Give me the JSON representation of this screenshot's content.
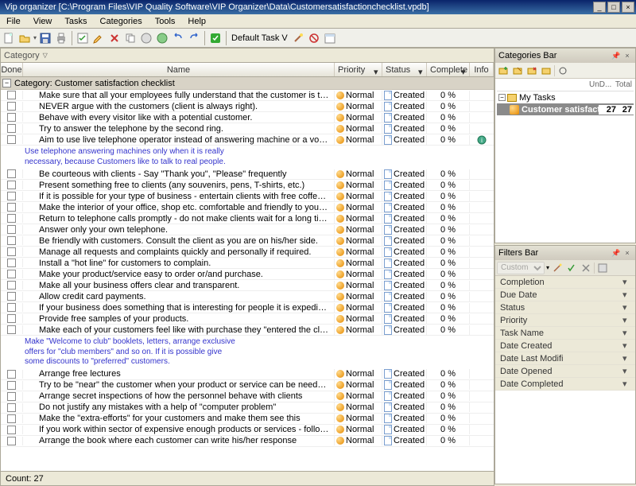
{
  "title": "Vip organizer [C:\\Program Files\\VIP Quality Software\\VIP Organizer\\Data\\Customersatisfactionchecklist.vpdb]",
  "menu": [
    "File",
    "View",
    "Tasks",
    "Categories",
    "Tools",
    "Help"
  ],
  "toolbar_dropdown": "Default Task V",
  "category_dropdown_label": "Category",
  "columns": {
    "done": "Done",
    "name": "Name",
    "priority": "Priority",
    "status": "Status",
    "complete": "Complete",
    "info": "Info"
  },
  "category_row": "Category: Customer satisfaction checklist",
  "priority_label": "Normal",
  "status_label": "Created",
  "complete_label": "0 %",
  "note1": "Use telephone answering machines only when it is really\nnecessary, because Customers like to talk to real people.",
  "note2": "Make \"Welcome to club\" booklets, letters, arrange exclusive\noffers for \"club members\" and so on. If it is possible give\nsome discounts to \"preferred\" customers.",
  "tasks_a": [
    "Make sure that all your employees fully understand that the customer is the number one in the business.",
    "NEVER argue with the customers (client is always right).",
    "Behave with every visitor like with a potential customer.",
    "Try to answer the telephone by the second ring.",
    "Aim to use live telephone operator instead of answering machine or a voice mail system."
  ],
  "tasks_b": [
    "Be courteous with clients - Say \"Thank you\", \"Please\" frequently",
    "Present something free to clients (any souvenirs, pens, T-shirts, etc.)",
    "If it is possible for your type of business - entertain clients with free coffee, cookies etc. while they wait.",
    "Make the interior of your office, shop etc. comfortable and friendly to your visitors and customers as much as possible.",
    "Return to telephone calls promptly - do not make clients wait for a long time.",
    "Answer only your own telephone.",
    "Be friendly with customers. Consult the client as you are on his/her side.",
    "Manage all requests and complaints quickly and personally if required.",
    "Install a \"hot line\" for customers to complain.",
    "Make your product/service easy to order or/and purchase.",
    "Make all your business offers clear and transparent.",
    "Allow credit card payments.",
    "If your business does something that is interesting for people it is expedient to arrange \"Doors open day\" periodically.",
    "Provide free samples of your products.",
    "Make each of your customers feel like with purchase they \"entered the club\"."
  ],
  "tasks_c": [
    "Arrange free lectures",
    "Try to be \"near\" the customer when your product or service can be needed (do not pester your clients)",
    "Arrange secret inspections of how the personnel behave with clients",
    "Do not justify any mistakes with a help of \"computer problem\"",
    "Make the \"extra-efforts\" for your customers and make them see this",
    "If you work within sector of expensive enough products or services - follow up each sale with a telephone call or written communication.",
    "Arrange the book where each customer can write his/her response"
  ],
  "status_count": "Count: 27",
  "categories_bar": {
    "title": "Categories Bar",
    "col_undone": "UnD...",
    "col_total": "Total",
    "root": "My Tasks",
    "item": "Customer satisfaction chec",
    "undone": "27",
    "total": "27"
  },
  "filters_bar": {
    "title": "Filters Bar",
    "preset": "Custom",
    "rows": [
      "Completion",
      "Due Date",
      "Status",
      "Priority",
      "Task Name",
      "Date Created",
      "Date Last Modifi",
      "Date Opened",
      "Date Completed"
    ]
  }
}
